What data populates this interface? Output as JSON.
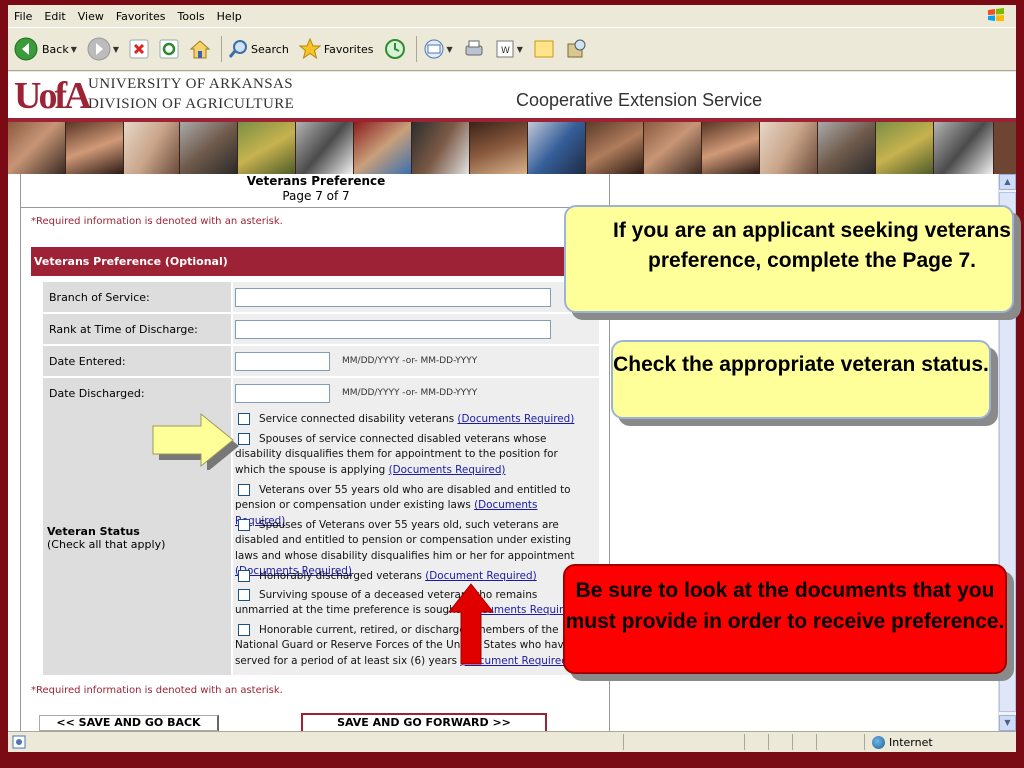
{
  "menu": [
    "File",
    "Edit",
    "View",
    "Favorites",
    "Tools",
    "Help"
  ],
  "toolbar": {
    "back": "Back",
    "search": "Search",
    "favorites": "Favorites"
  },
  "header": {
    "logo": "UofA",
    "line1": "UNIVERSITY OF ARKANSAS",
    "line2": "DIVISION OF AGRICULTURE",
    "service": "Cooperative Extension Service"
  },
  "page": {
    "title": "Veterans Preference",
    "page_num": "Page 7 of 7",
    "required_note": "*Required information is denoted with an asterisk.",
    "section": "Veterans Preference (Optional)"
  },
  "fields": [
    {
      "label": "Branch of Service:",
      "value": ""
    },
    {
      "label": "Rank at Time of Discharge:",
      "value": ""
    },
    {
      "label": "Date Entered:",
      "value": "",
      "hint": "MM/DD/YYYY -or- MM-DD-YYYY"
    },
    {
      "label": "Date Discharged:",
      "value": "",
      "hint": "MM/DD/YYYY -or- MM-DD-YYYY"
    }
  ],
  "veteran_status": {
    "label": "Veteran Status",
    "sub": "(Check all that apply)",
    "options": [
      {
        "text": "Service connected disability veterans",
        "link": "(Documents Required)",
        "checked": false
      },
      {
        "text": "Spouses of service connected disabled veterans whose disability disqualifies them for appointment to the position for which the spouse is applying",
        "link": "(Documents Required)",
        "checked": false
      },
      {
        "text": "Veterans over 55 years old who are disabled and entitled to pension or compensation under existing laws",
        "link": "(Documents Required)",
        "checked": false
      },
      {
        "text": "Spouses of Veterans over 55 years old, such veterans are disabled and entitled to pension or compensation under existing laws and whose disability disqualifies him or her for appointment",
        "link": "(Documents Required)",
        "checked": false
      },
      {
        "text": "Honorably discharged veterans",
        "link": "(Document Required)",
        "checked": false
      },
      {
        "text": "Surviving spouse of a deceased veteran who remains unmarried at the time preference is sought",
        "link": "(Documents Required)",
        "checked": false
      },
      {
        "text": "Honorable current, retired, or discharged members of the National Guard or Reserve Forces of the United States who have served for a period of at least six (6) years",
        "link": "(Document Required)",
        "checked": false
      }
    ]
  },
  "buttons": {
    "back": "<< SAVE AND GO BACK",
    "forward": "SAVE AND GO FORWARD >>"
  },
  "status": {
    "zone": "Internet"
  },
  "callouts": {
    "c1": "If you are an applicant seeking veterans preference, complete the Page 7.",
    "c2": "Check the appropriate veteran status.",
    "c3": "Be sure to look at the documents that you must provide in order to receive preference."
  },
  "colors": {
    "frame": "#7a0a14",
    "brand": "#9d2235",
    "callout_yellow": "#ffff99",
    "callout_red": "#ff0000",
    "arrow_red": "#e00000"
  }
}
